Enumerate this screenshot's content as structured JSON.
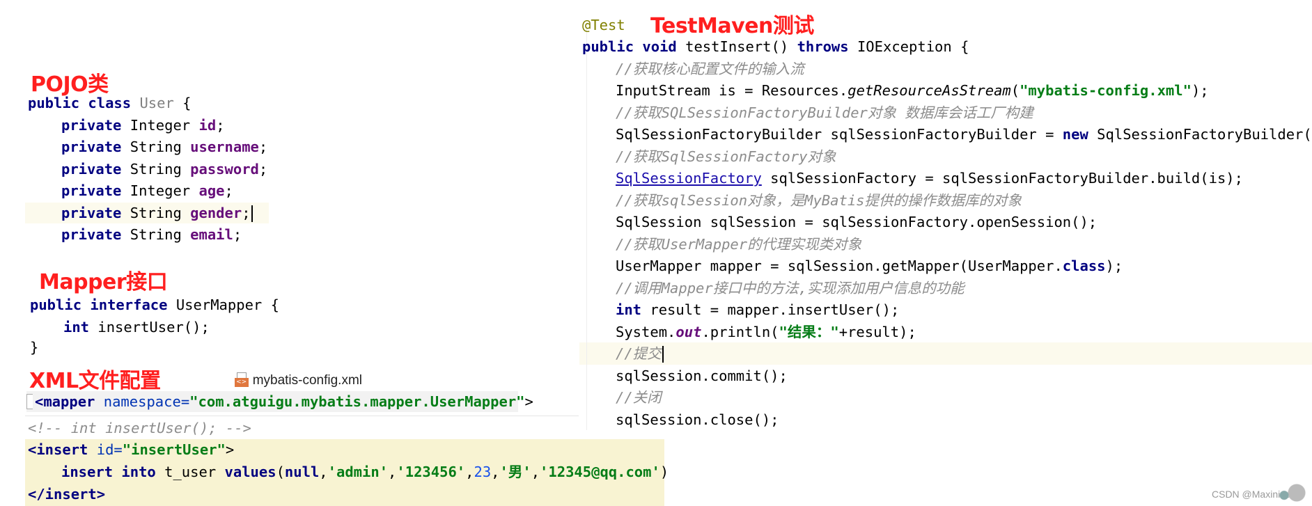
{
  "headings": {
    "pojo": "POJO类",
    "mapper": "Mapper接口",
    "xml": "XML文件配置",
    "test": "TestMaven测试"
  },
  "pojo": {
    "decl": [
      "public class",
      " User ",
      "{"
    ],
    "fields": [
      {
        "mod": "private",
        "type": " Integer ",
        "name": "id",
        "end": ";"
      },
      {
        "mod": "private",
        "type": " String ",
        "name": "username",
        "end": ";"
      },
      {
        "mod": "private",
        "type": " String ",
        "name": "password",
        "end": ";"
      },
      {
        "mod": "private",
        "type": " Integer ",
        "name": "age",
        "end": ";"
      },
      {
        "mod": "private",
        "type": " String ",
        "name": "gender",
        "end": ";"
      },
      {
        "mod": "private",
        "type": " String ",
        "name": "email",
        "end": ";"
      }
    ]
  },
  "mapper": {
    "decl_kw": "public interface",
    "decl_rest": " UserMapper {",
    "method_kw": "int",
    "method_rest": " insertUser();",
    "close": "}"
  },
  "xml": {
    "file_label": "mybatis-config.xml",
    "mapper_open_tag": "<mapper",
    "mapper_attr": " namespace=",
    "mapper_value": "\"com.atguigu.mybatis.mapper.UserMapper\"",
    "mapper_gt": ">",
    "comment": "<!-- int insertUser(); -->",
    "insert_open_tag": "<insert",
    "insert_attr": " id=",
    "insert_value": "\"insertUser\"",
    "insert_gt": ">",
    "sql_kw1": "insert into",
    "sql_mid": " t_user ",
    "sql_kw2": "values",
    "sql_paren": "(",
    "sql_null": "null",
    "sql_c1": ",",
    "sql_v1": "'admin'",
    "sql_c2": ",",
    "sql_v2": "'123456'",
    "sql_c3": ",",
    "sql_v3": "23",
    "sql_c4": ",",
    "sql_v4": "'男'",
    "sql_c5": ",",
    "sql_v5": "'12345@qq.com'",
    "sql_end": ")",
    "insert_close": "</insert>"
  },
  "test": {
    "annotation": "@Test",
    "sig_kw1": "public void",
    "sig_name": " testInsert() ",
    "sig_kw2": "throws",
    "sig_rest": " IOException {",
    "c1": "//获取核心配置文件的输入流",
    "l1_a": "InputStream is = Resources.",
    "l1_m": "getResourceAsStream",
    "l1_b": "(",
    "l1_s": "\"mybatis-config.xml\"",
    "l1_c": ");",
    "c2": "//获取SQLSessionFactoryBuilder对象 数据库会话工厂构建",
    "l2_a": "SqlSessionFactoryBuilder sqlSessionFactoryBuilder = ",
    "l2_kw": "new",
    "l2_b": " SqlSessionFactoryBuilder();",
    "c3": "//获取SqlSessionFactory对象",
    "l3_link": "SqlSessionFactory",
    "l3_rest": " sqlSessionFactory = sqlSessionFactoryBuilder.build(is);",
    "c4": "//获取sqlSession对象，是MyBatis提供的操作数据库的对象",
    "l4": "SqlSession sqlSession = sqlSessionFactory.openSession();",
    "c5": "//获取UserMapper的代理实现类对象",
    "l5_a": "UserMapper mapper = sqlSession.getMapper(UserMapper.",
    "l5_kw": "class",
    "l5_b": ");",
    "c6": "//调用Mapper接口中的方法,实现添加用户信息的功能",
    "l6_kw": "int",
    "l6_rest": " result = mapper.insertUser();",
    "l7_a": "System.",
    "l7_out": "out",
    "l7_b": ".println(",
    "l7_s": "\"结果：\"",
    "l7_c": "+result);",
    "c7": "//提交",
    "l8": "sqlSession.commit();",
    "c8": "//关闭",
    "l9": "sqlSession.close();"
  },
  "watermark": "CSDN @Maxinize"
}
